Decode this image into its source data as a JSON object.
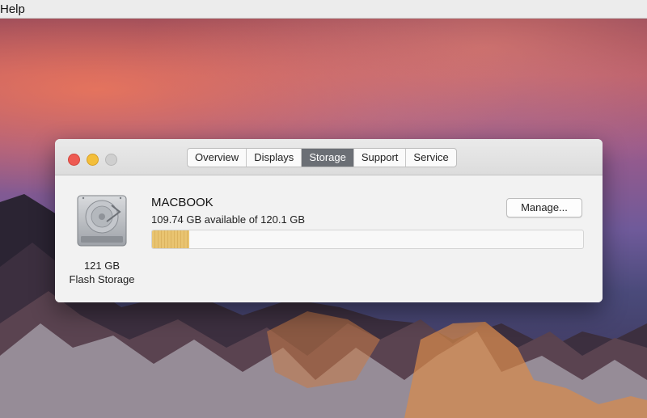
{
  "menubar": {
    "help_label": "Help"
  },
  "window": {
    "tabs": [
      {
        "label": "Overview",
        "active": false
      },
      {
        "label": "Displays",
        "active": false
      },
      {
        "label": "Storage",
        "active": true
      },
      {
        "label": "Support",
        "active": false
      },
      {
        "label": "Service",
        "active": false
      }
    ]
  },
  "storage": {
    "disk_icon": "hard-drive-icon",
    "disk_size": "121 GB",
    "disk_type": "Flash Storage",
    "volume_name": "MACBOOK",
    "available_text": "109.74 GB available of 120.1 GB",
    "used_fraction": 0.086,
    "used_color": "#e9c471",
    "manage_label": "Manage..."
  }
}
